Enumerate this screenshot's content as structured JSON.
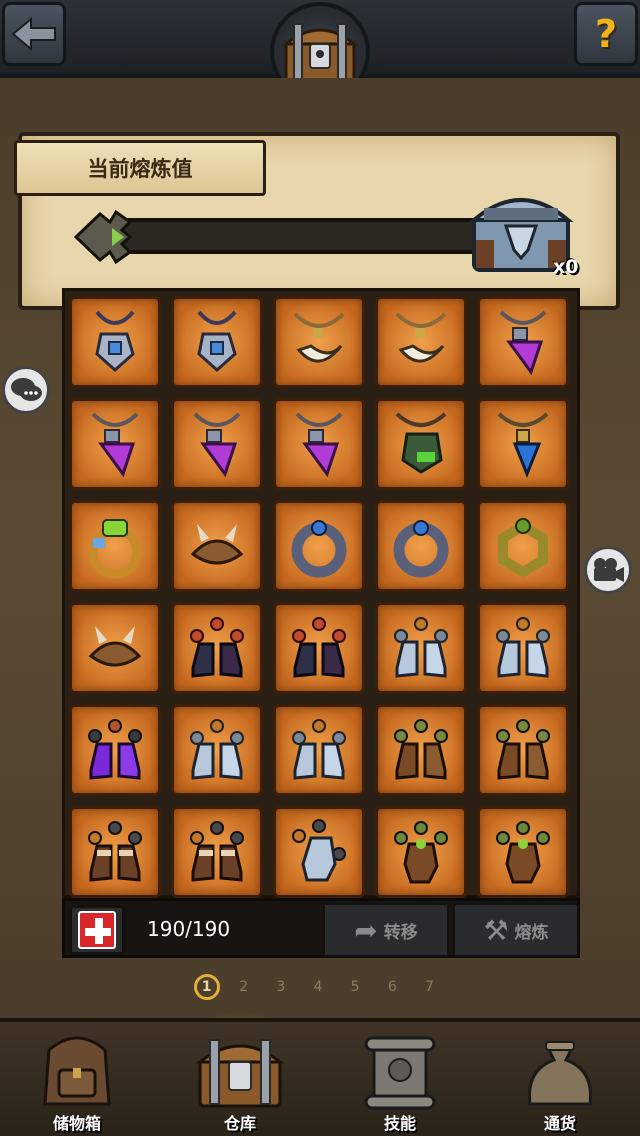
{
  "header": {
    "back_icon": "arrow-left-icon",
    "help_label": "?",
    "center_icon": "treasure-chest-icon"
  },
  "smelt_panel": {
    "title": "当前熔炼值",
    "progress": 0.0,
    "reward_icon": "silver-chest-icon",
    "reward_count": "x0"
  },
  "inventory": {
    "rows": [
      [
        "blue-gem-amulet",
        "blue-gem-amulet",
        "fang-necklace",
        "fang-necklace",
        "purple-gem-amulet"
      ],
      [
        "purple-gem-amulet",
        "purple-gem-amulet",
        "purple-gem-amulet",
        "green-gem-amulet",
        "blue-crystal-pendant"
      ],
      [
        "emerald-ring",
        "horned-bracelet",
        "sapphire-ring",
        "sapphire-ring",
        "jade-ring"
      ],
      [
        "horned-bracelet",
        "dark-boots",
        "dark-boots",
        "steel-boots",
        "steel-boots"
      ],
      [
        "purple-boots",
        "steel-boots",
        "steel-boots",
        "leather-boots",
        "leather-boots"
      ],
      [
        "brown-boots",
        "brown-boots",
        "steel-gauntlet",
        "leather-glove",
        "leather-glove"
      ]
    ]
  },
  "footer": {
    "capacity": "190/190",
    "transfer_label": "转移",
    "smelt_label": "熔炼"
  },
  "pager": {
    "pages": [
      "1",
      "2",
      "3",
      "4",
      "5",
      "6",
      "7"
    ],
    "active": 0
  },
  "side": {
    "chat_icon": "chat-bubble-icon",
    "video_icon": "video-camera-icon"
  },
  "nav": {
    "items": [
      {
        "label": "储物箱",
        "icon": "backpack-icon"
      },
      {
        "label": "仓库",
        "icon": "treasure-chest-icon"
      },
      {
        "label": "技能",
        "icon": "skill-scroll-icon"
      },
      {
        "label": "通货",
        "icon": "money-bag-icon"
      }
    ],
    "active": 1
  },
  "colors": {
    "slot_orange": "#d9832f",
    "progress_green": "#6fb33a",
    "gold_accent": "#e6b038"
  }
}
